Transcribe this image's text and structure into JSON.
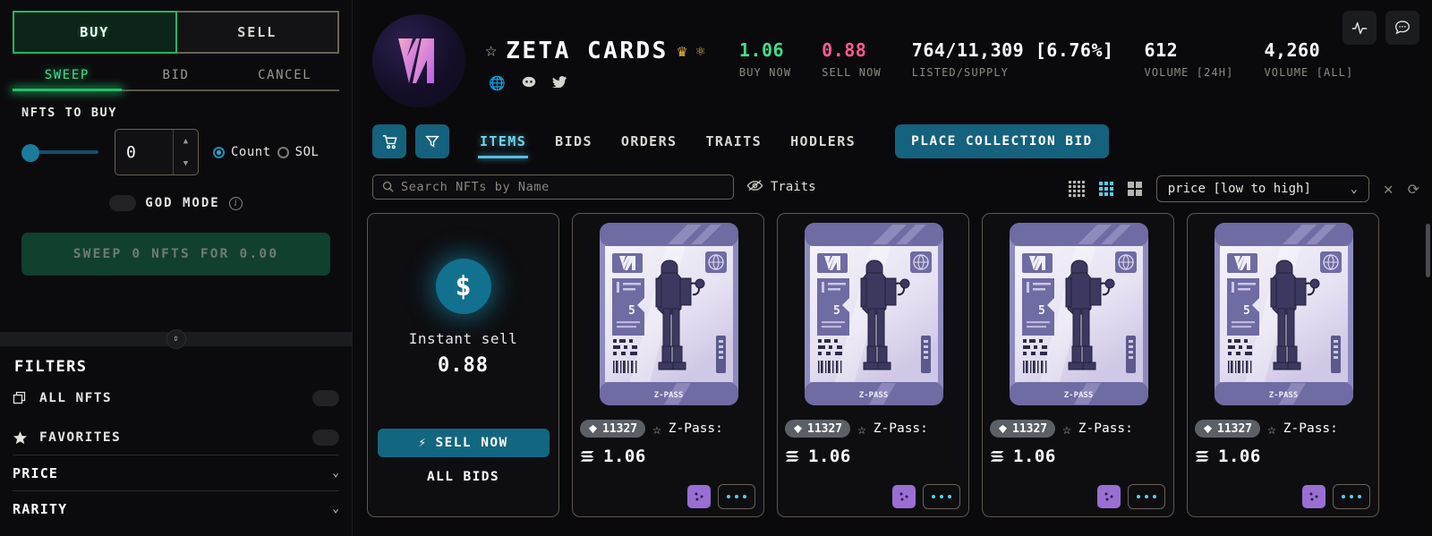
{
  "sidebar": {
    "mode_tabs": [
      {
        "label": "BUY",
        "active": true
      },
      {
        "label": "SELL",
        "active": false
      }
    ],
    "action_tabs": [
      {
        "label": "SWEEP",
        "active": true
      },
      {
        "label": "BID",
        "active": false
      },
      {
        "label": "CANCEL",
        "active": false
      }
    ],
    "nfts_to_buy_label": "NFTS TO BUY",
    "quantity_value": "0",
    "unit_options": [
      {
        "label": "Count",
        "selected": true
      },
      {
        "label": "SOL",
        "selected": false
      }
    ],
    "god_mode_label": "GOD MODE",
    "god_mode_info": "i",
    "sweep_button": "SWEEP 0 NFTS FOR 0.00",
    "filters": {
      "heading": "FILTERS",
      "rows": [
        {
          "label": "ALL NFTS",
          "icon": "copy-icon"
        },
        {
          "label": "FAVORITES",
          "icon": "star-icon"
        }
      ],
      "sections": [
        {
          "label": "PRICE"
        },
        {
          "label": "RARITY"
        }
      ]
    }
  },
  "header": {
    "collection_name": "ZETA CARDS",
    "badges": [
      "crown-icon",
      "atom-icon"
    ],
    "socials": [
      "globe-icon",
      "discord-icon",
      "twitter-icon"
    ],
    "stats": [
      {
        "value": "1.06",
        "label": "BUY NOW",
        "color": "#3ee08a"
      },
      {
        "value": "0.88",
        "label": "SELL NOW",
        "color": "#ff5d8f"
      },
      {
        "value": "764/11,309 [6.76%]",
        "label": "LISTED/SUPPLY",
        "color": "#ffffff"
      },
      {
        "value": "612",
        "label": "VOLUME [24H]",
        "color": "#ffffff"
      },
      {
        "value": "4,260",
        "label": "VOLUME [ALL]",
        "color": "#ffffff"
      }
    ]
  },
  "toolbar": {
    "cart_icon": "cart-icon",
    "filter_icon": "funnel-icon",
    "tabs": [
      {
        "label": "ITEMS",
        "active": true
      },
      {
        "label": "BIDS",
        "active": false
      },
      {
        "label": "ORDERS",
        "active": false
      },
      {
        "label": "TRAITS",
        "active": false
      },
      {
        "label": "HODLERS",
        "active": false
      }
    ],
    "place_collection_bid": "PLACE COLLECTION BID",
    "activity_icon": "activity-icon",
    "chat_icon": "chat-icon"
  },
  "search": {
    "placeholder": "Search NFTs by Name",
    "traits_label": "Traits"
  },
  "view": {
    "density_options": [
      "grid-4-icon",
      "grid-3-icon",
      "grid-2-icon"
    ],
    "active_density": 1,
    "sort_value": "price [low to high]",
    "clear_icon": "close-icon",
    "refresh_icon": "refresh-icon"
  },
  "instant_sell": {
    "icon": "dollar-icon",
    "title": "Instant sell",
    "price": "0.88",
    "sell_button": "SELL NOW",
    "all_bids": "ALL BIDS"
  },
  "cards": [
    {
      "rank": "11327",
      "name": "Z-Pass:",
      "price": "1.06",
      "art_label": "Z-PASS",
      "art_number": "5"
    },
    {
      "rank": "11327",
      "name": "Z-Pass:",
      "price": "1.06",
      "art_label": "Z-PASS",
      "art_number": "5"
    },
    {
      "rank": "11327",
      "name": "Z-Pass:",
      "price": "1.06",
      "art_label": "Z-PASS",
      "art_number": "5"
    },
    {
      "rank": "11327",
      "name": "Z-Pass:",
      "price": "1.06",
      "art_label": "Z-PASS",
      "art_number": "5"
    }
  ]
}
